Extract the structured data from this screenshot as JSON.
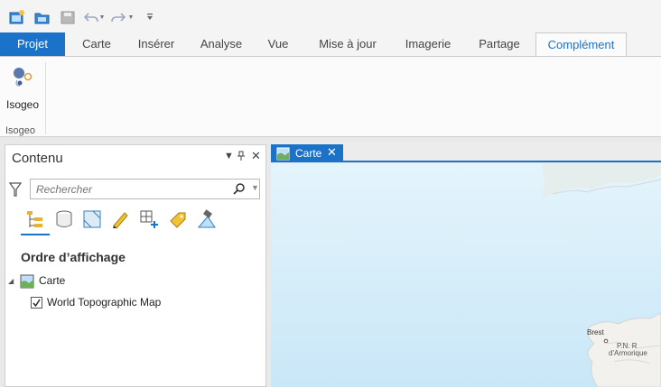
{
  "quick_access": {
    "icons": [
      "new-project-icon",
      "open-project-icon",
      "save-project-icon",
      "undo-icon",
      "redo-icon",
      "customize-qat-icon"
    ]
  },
  "tabs": [
    {
      "label": "Projet",
      "state": "project"
    },
    {
      "label": "Carte"
    },
    {
      "label": "Insérer"
    },
    {
      "label": "Analyse"
    },
    {
      "label": "Vue"
    },
    {
      "label": "Mise à jour"
    },
    {
      "label": "Imagerie"
    },
    {
      "label": "Partage"
    },
    {
      "label": "Complément",
      "state": "active"
    }
  ],
  "ribbon": {
    "isogeo_button": "Isogeo",
    "group_label": "Isogeo"
  },
  "contents": {
    "title": "Contenu",
    "search_placeholder": "Rechercher",
    "tools": [
      "list-by-drawing-order-icon",
      "list-by-data-source-icon",
      "list-by-selection-icon",
      "list-by-editing-icon",
      "list-by-snapping-icon",
      "list-by-labeling-icon",
      "list-by-perspective-imagery-icon"
    ],
    "draw_order_heading": "Ordre d’affichage",
    "map_node": "Carte",
    "layers": [
      {
        "name": "World Topographic Map",
        "checked": true
      }
    ]
  },
  "map_view": {
    "tab_label": "Carte",
    "labels": {
      "city": "Brest",
      "park_line1": "P.N. R",
      "park_line2": "d'Armorique"
    }
  },
  "colors": {
    "accent": "#1a73c9",
    "sea": "#d7eefa",
    "land": "#f2f1ee"
  }
}
